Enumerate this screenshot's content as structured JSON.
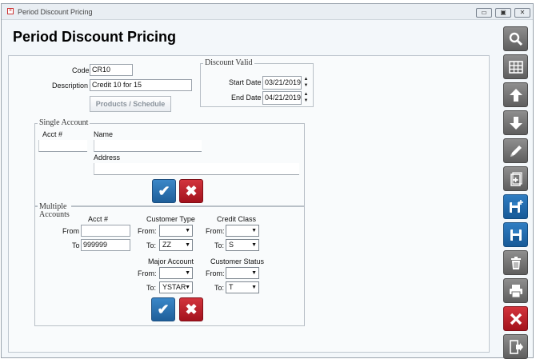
{
  "window": {
    "title": "Period Discount Pricing"
  },
  "page": {
    "title": "Period Discount Pricing"
  },
  "form": {
    "code_label": "Code",
    "code_value": "CR10",
    "description_label": "Description",
    "description_value": "Credit 10 for 15",
    "products_button": "Products / Schedule"
  },
  "discount_valid": {
    "legend": "Discount Valid",
    "start_label": "Start Date",
    "start_value": "03/21/2019",
    "end_label": "End Date",
    "end_value": "04/21/2019"
  },
  "single_account": {
    "legend": "Single Account",
    "acct_label": "Acct #",
    "acct_value": "",
    "name_label": "Name",
    "name_value": "",
    "address_label": "Address",
    "address_value": ""
  },
  "multiple_accounts": {
    "legend_line1": "Multiple",
    "legend_line2": "Accounts",
    "acct_label": "Acct #",
    "from_label": "From",
    "acct_from_value": "",
    "to_label": "To",
    "acct_to_value": "999999",
    "customer_type_label": "Customer Type",
    "ct_from_label": "From:",
    "ct_from_value": "",
    "ct_to_label": "To:",
    "ct_to_value": "ZZ",
    "credit_class_label": "Credit Class",
    "cc_from_label": "From:",
    "cc_from_value": "",
    "cc_to_label": "To:",
    "cc_to_value": "S",
    "major_account_label": "Major Account",
    "ma_from_label": "From:",
    "ma_from_value": "",
    "ma_to_label": "To:",
    "ma_to_value": "YSTAR",
    "customer_status_label": "Customer Status",
    "cs_from_label": "From:",
    "cs_from_value": "",
    "cs_to_label": "To:",
    "cs_to_value": "T"
  },
  "toolbar": {
    "icons": [
      "search-icon",
      "grid-icon",
      "arrow-up-icon",
      "arrow-down-icon",
      "pencil-icon",
      "add-document-icon",
      "save-new-icon",
      "save-icon",
      "trash-icon",
      "print-icon",
      "close-icon",
      "exit-icon"
    ]
  },
  "colors": {
    "accent_blue": "#1f5f9a",
    "danger_red": "#a3121d",
    "toolbar_gray": "#6e6e6e"
  }
}
